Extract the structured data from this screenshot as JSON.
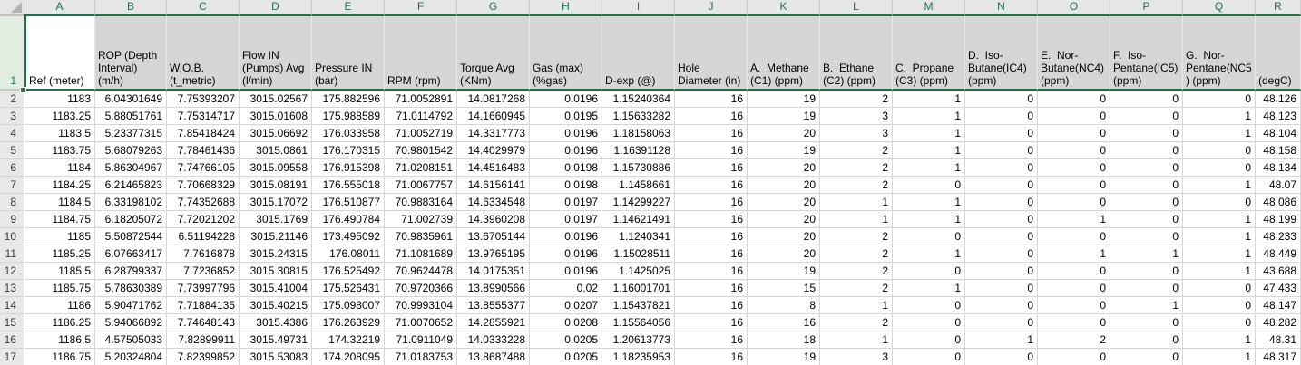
{
  "app": {
    "type": "spreadsheet-grid",
    "selected_range": "row 1"
  },
  "colors": {
    "accent_green": "#217346",
    "selection_fill": "#D6D6D6",
    "header_strip_fill": "#E6E6E6",
    "selected_row_header_fill": "#E2EDE2",
    "gridline": "#D6D6D6",
    "active_cell_fill": "#FFFFFF"
  },
  "column_letters": [
    "A",
    "B",
    "C",
    "D",
    "E",
    "F",
    "G",
    "H",
    "I",
    "J",
    "K",
    "L",
    "M",
    "N",
    "O",
    "P",
    "Q",
    "R"
  ],
  "header_row": {
    "row_num": "1",
    "cells": [
      "Ref (meter)",
      "ROP (Depth Interval) (m/h)",
      "W.O.B. (t_metric)",
      "Flow IN (Pumps) Avg (l/min)",
      "Pressure IN (bar)",
      "RPM (rpm)",
      "Torque Avg (KNm)",
      "Gas (max) (%gas)",
      "D-exp (@)",
      "Hole Diameter (in)",
      "A.  Methane (C1) (ppm)",
      "B.  Ethane (C2) (ppm)",
      "C.  Propane (C3) (ppm)",
      "D.  Iso-Butane(IC4) (ppm)",
      "E.  Nor-Butane(NC4) (ppm)",
      "F.  Iso-Pentane(IC5) (ppm)",
      "G.  Nor-Pentane(NC5) (ppm)",
      "(degC)"
    ]
  },
  "data_rows": [
    {
      "row_num": "2",
      "cells": [
        "1183",
        "6.04301649",
        "7.75393207",
        "3015.02567",
        "175.882596",
        "71.0052891",
        "14.0817268",
        "0.0196",
        "1.15240364",
        "16",
        "19",
        "2",
        "1",
        "0",
        "0",
        "0",
        "0",
        "48.126"
      ]
    },
    {
      "row_num": "3",
      "cells": [
        "1183.25",
        "5.88051761",
        "7.75314717",
        "3015.01608",
        "175.988589",
        "71.0114792",
        "14.1660945",
        "0.0195",
        "1.15633282",
        "16",
        "19",
        "3",
        "1",
        "0",
        "0",
        "0",
        "1",
        "48.123"
      ]
    },
    {
      "row_num": "4",
      "cells": [
        "1183.5",
        "5.23377315",
        "7.85418424",
        "3015.06692",
        "176.033958",
        "71.0052719",
        "14.3317773",
        "0.0196",
        "1.18158063",
        "16",
        "20",
        "3",
        "1",
        "0",
        "0",
        "0",
        "1",
        "48.104"
      ]
    },
    {
      "row_num": "5",
      "cells": [
        "1183.75",
        "5.68079263",
        "7.78461436",
        "3015.0861",
        "176.170315",
        "70.9801542",
        "14.4029979",
        "0.0196",
        "1.16391128",
        "16",
        "19",
        "2",
        "1",
        "0",
        "0",
        "0",
        "0",
        "48.158"
      ]
    },
    {
      "row_num": "6",
      "cells": [
        "1184",
        "5.86304967",
        "7.74766105",
        "3015.09558",
        "176.915398",
        "71.0208151",
        "14.4516483",
        "0.0198",
        "1.15730886",
        "16",
        "20",
        "2",
        "1",
        "0",
        "0",
        "0",
        "0",
        "48.134"
      ]
    },
    {
      "row_num": "7",
      "cells": [
        "1184.25",
        "6.21465823",
        "7.70668329",
        "3015.08191",
        "176.555018",
        "71.0067757",
        "14.6156141",
        "0.0198",
        "1.1458661",
        "16",
        "20",
        "2",
        "0",
        "0",
        "0",
        "0",
        "1",
        "48.07"
      ]
    },
    {
      "row_num": "8",
      "cells": [
        "1184.5",
        "6.33198102",
        "7.74352688",
        "3015.17072",
        "176.510877",
        "70.9883164",
        "14.6334548",
        "0.0197",
        "1.14299227",
        "16",
        "20",
        "1",
        "1",
        "0",
        "0",
        "0",
        "0",
        "48.086"
      ]
    },
    {
      "row_num": "9",
      "cells": [
        "1184.75",
        "6.18205072",
        "7.72021202",
        "3015.1769",
        "176.490784",
        "71.002739",
        "14.3960208",
        "0.0197",
        "1.14621491",
        "16",
        "20",
        "1",
        "1",
        "0",
        "1",
        "0",
        "1",
        "48.199"
      ]
    },
    {
      "row_num": "10",
      "cells": [
        "1185",
        "5.50872544",
        "6.51194228",
        "3015.21146",
        "173.495092",
        "70.9835961",
        "13.6705144",
        "0.0196",
        "1.1240341",
        "16",
        "20",
        "2",
        "0",
        "0",
        "0",
        "0",
        "1",
        "48.233"
      ]
    },
    {
      "row_num": "11",
      "cells": [
        "1185.25",
        "6.07663417",
        "7.7616878",
        "3015.24315",
        "176.08011",
        "71.1081689",
        "13.9765195",
        "0.0196",
        "1.15028511",
        "16",
        "20",
        "2",
        "1",
        "0",
        "1",
        "1",
        "1",
        "48.449"
      ]
    },
    {
      "row_num": "12",
      "cells": [
        "1185.5",
        "6.28799337",
        "7.7236852",
        "3015.30815",
        "176.525492",
        "70.9624478",
        "14.0175351",
        "0.0196",
        "1.1425025",
        "16",
        "19",
        "2",
        "0",
        "0",
        "0",
        "0",
        "1",
        "43.688"
      ]
    },
    {
      "row_num": "13",
      "cells": [
        "1185.75",
        "5.78630389",
        "7.73997796",
        "3015.41004",
        "175.526431",
        "70.9720366",
        "13.8990566",
        "0.02",
        "1.16001701",
        "16",
        "15",
        "2",
        "1",
        "0",
        "0",
        "0",
        "0",
        "47.433"
      ]
    },
    {
      "row_num": "14",
      "cells": [
        "1186",
        "5.90471762",
        "7.71884135",
        "3015.40215",
        "175.098007",
        "70.9993104",
        "13.8555377",
        "0.0207",
        "1.15437821",
        "16",
        "8",
        "1",
        "0",
        "0",
        "0",
        "1",
        "0",
        "48.147"
      ]
    },
    {
      "row_num": "15",
      "cells": [
        "1186.25",
        "5.94066892",
        "7.74648143",
        "3015.4386",
        "176.263929",
        "71.0070652",
        "14.2855921",
        "0.0208",
        "1.15564056",
        "16",
        "16",
        "2",
        "0",
        "0",
        "0",
        "0",
        "0",
        "48.282"
      ]
    },
    {
      "row_num": "16",
      "cells": [
        "1186.5",
        "4.57505033",
        "7.82899911",
        "3015.49731",
        "174.32219",
        "71.0911049",
        "14.0333228",
        "0.0205",
        "1.20613773",
        "16",
        "18",
        "1",
        "0",
        "1",
        "2",
        "0",
        "1",
        "48.31"
      ]
    },
    {
      "row_num": "17",
      "cells": [
        "1186.75",
        "5.20324804",
        "7.82399852",
        "3015.53083",
        "174.208095",
        "71.0183753",
        "13.8687488",
        "0.0205",
        "1.18235953",
        "16",
        "19",
        "3",
        "0",
        "0",
        "0",
        "0",
        "1",
        "48.317"
      ]
    }
  ]
}
